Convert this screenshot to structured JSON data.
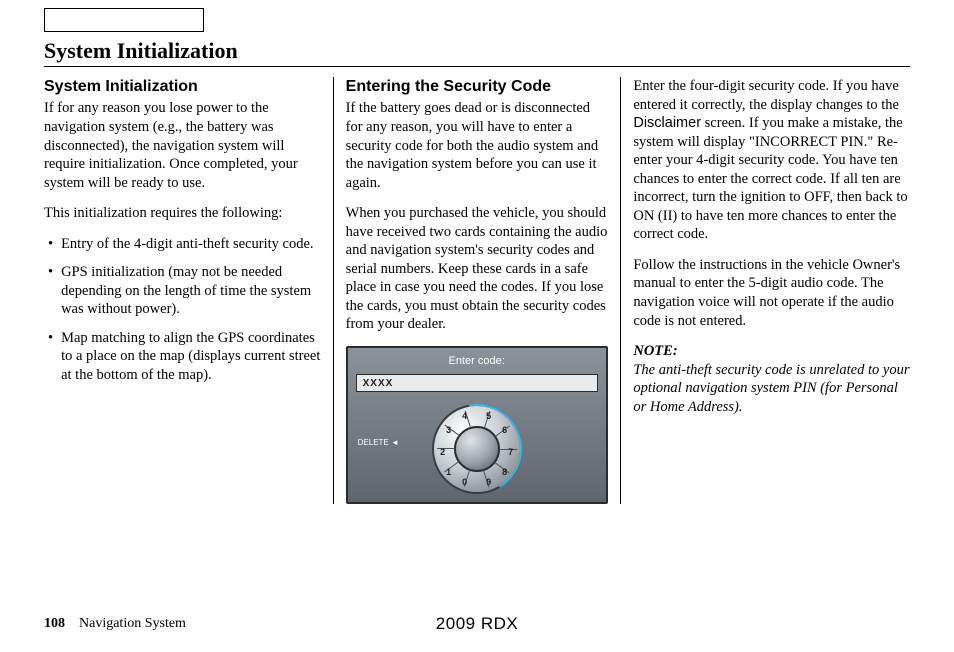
{
  "pageTitle": "System Initialization",
  "col1": {
    "heading": "System Initialization",
    "p1": "If for any reason you lose power to the navigation system (e.g., the battery was disconnected), the navigation system will require initialization. Once completed, your system will be ready to use.",
    "p2": "This initialization requires the following:",
    "bullets": [
      "Entry of the 4-digit anti-theft security code.",
      "GPS initialization (may not be needed depending on the length of time the system was without power).",
      "Map matching to align the GPS coordinates to a place on the map (displays current street at the bottom of the map)."
    ]
  },
  "col2": {
    "heading": "Entering the Security Code",
    "p1": "If the battery goes dead or is disconnected for any reason, you will have to enter a security code for both the audio system and the navigation system before you can use it again.",
    "p2": "When you purchased the vehicle, you should have received two cards containing the audio and navigation system's security codes and serial numbers. Keep these cards in a safe place in case you need the codes. If you lose the cards, you must obtain the security codes from your dealer.",
    "screen": {
      "title": "Enter code:",
      "inputValue": "XXXX",
      "deleteLabel": "DELETE ◄",
      "digits": [
        "1",
        "2",
        "3",
        "4",
        "5",
        "6",
        "7",
        "8",
        "9",
        "0"
      ]
    }
  },
  "col3": {
    "p1_pre": "Enter the four-digit security code. If you have entered it correctly, the display changes to the ",
    "p1_term": "Disclaimer",
    "p1_post": " screen. If you make a mistake, the system will display \"INCORRECT PIN.\" Re-enter your 4-digit security code. You have ten chances to enter the correct code. If all ten are incorrect, turn the ignition to OFF, then back to ON (II) to have ten more chances to enter the correct code.",
    "p2": "Follow the instructions in the vehicle Owner's manual to enter the 5-digit audio code. The navigation voice will not operate if the audio code is not entered.",
    "noteLabel": "NOTE:",
    "noteText": "The anti-theft security code is unrelated to your optional navigation system PIN (for Personal or Home Address)."
  },
  "footer": {
    "pageNum": "108",
    "section": "Navigation System",
    "centerLabel": "2009 RDX"
  }
}
